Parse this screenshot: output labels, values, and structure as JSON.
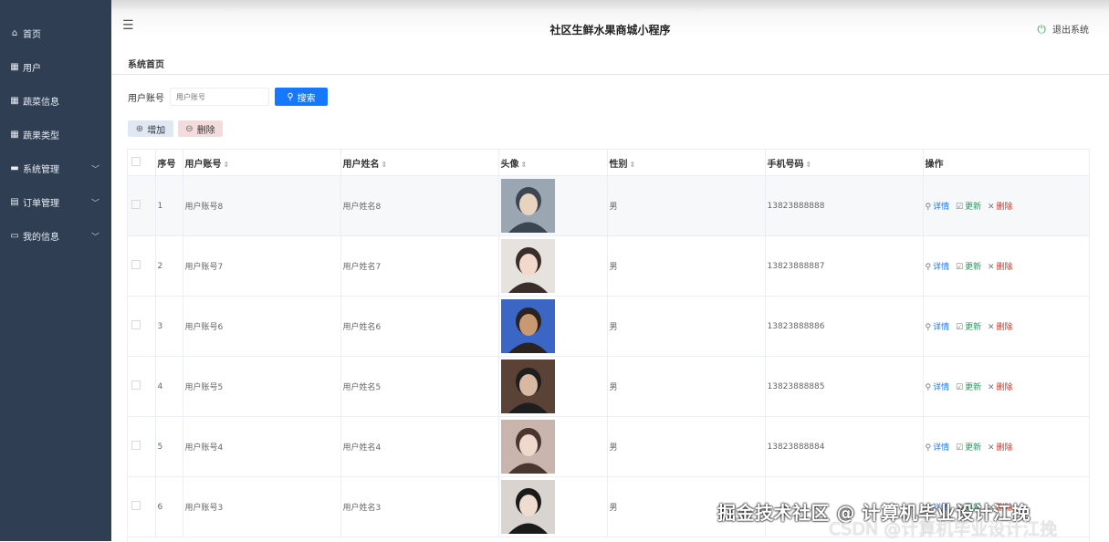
{
  "app": {
    "title": "社区生鲜水果商城小程序",
    "logout_label": "退出系统"
  },
  "sidebar": {
    "items": [
      {
        "label": "首页",
        "icon": "home-icon",
        "expandable": false
      },
      {
        "label": "用户",
        "icon": "grid-icon",
        "expandable": false
      },
      {
        "label": "蔬菜信息",
        "icon": "grid-icon",
        "expandable": false
      },
      {
        "label": "蔬果类型",
        "icon": "grid-icon",
        "expandable": false
      },
      {
        "label": "系统管理",
        "icon": "briefcase-icon",
        "expandable": true
      },
      {
        "label": "订单管理",
        "icon": "clipboard-icon",
        "expandable": true
      },
      {
        "label": "我的信息",
        "icon": "card-icon",
        "expandable": true
      }
    ]
  },
  "breadcrumb": "系统首页",
  "search": {
    "label": "用户账号",
    "placeholder": "用户账号",
    "button_label": "搜索"
  },
  "actions": {
    "add_label": "增加",
    "delete_label": "删除"
  },
  "table": {
    "columns": [
      "序号",
      "用户账号",
      "用户姓名",
      "头像",
      "性别",
      "手机号码",
      "操作"
    ],
    "operations": {
      "detail": "详情",
      "update": "更新",
      "delete": "删除"
    },
    "rows": [
      {
        "index": "1",
        "account": "用户账号8",
        "name": "用户姓名8",
        "gender": "男",
        "phone": "13823888888"
      },
      {
        "index": "2",
        "account": "用户账号7",
        "name": "用户姓名7",
        "gender": "男",
        "phone": "13823888887"
      },
      {
        "index": "3",
        "account": "用户账号6",
        "name": "用户姓名6",
        "gender": "男",
        "phone": "13823888886"
      },
      {
        "index": "4",
        "account": "用户账号5",
        "name": "用户姓名5",
        "gender": "男",
        "phone": "13823888885"
      },
      {
        "index": "5",
        "account": "用户账号4",
        "name": "用户姓名4",
        "gender": "男",
        "phone": "13823888884"
      },
      {
        "index": "6",
        "account": "用户账号3",
        "name": "用户姓名3",
        "gender": "男",
        "phone": ""
      }
    ]
  },
  "watermark": {
    "line1": "掘金技术社区 @ 计算机毕业设计江挽",
    "line2": "CSDN @计算机毕业设计江挽"
  },
  "colors": {
    "sidebar_bg": "#2f3e52",
    "primary": "#1677ff",
    "update": "#2a9d5c",
    "danger": "#c0392b",
    "logout_icon": "#3cab5a"
  }
}
